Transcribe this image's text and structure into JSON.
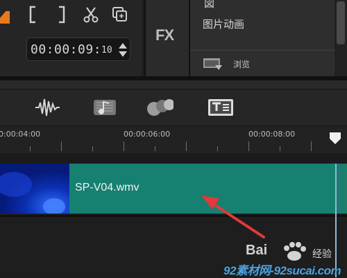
{
  "toolbar": {
    "timecode": "00:00:09:",
    "frame": "10",
    "icons": [
      "mark-in-icon",
      "mark-out-icon",
      "split-scissors-icon",
      "copy-icon"
    ]
  },
  "fx_label": "FX",
  "library": {
    "top_item": "図",
    "item_anim": "图片动画",
    "browse_label": "浏览"
  },
  "tools": [
    "audio-wave-icon",
    "music-note-icon",
    "overlay-circles-icon",
    "title-icon"
  ],
  "ruler": {
    "labels": [
      "0:00:04:00",
      "00:00:06:00",
      "00:00:08:00"
    ]
  },
  "clip": {
    "name": "SP-V04.wmv"
  },
  "watermark": {
    "baidu": "Bai",
    "jingyan": "经验",
    "site": "92素材网-92sucai.com"
  },
  "colors": {
    "clip": "#168071",
    "arrow": "#e03a3a",
    "accent": "#e87a1c"
  }
}
